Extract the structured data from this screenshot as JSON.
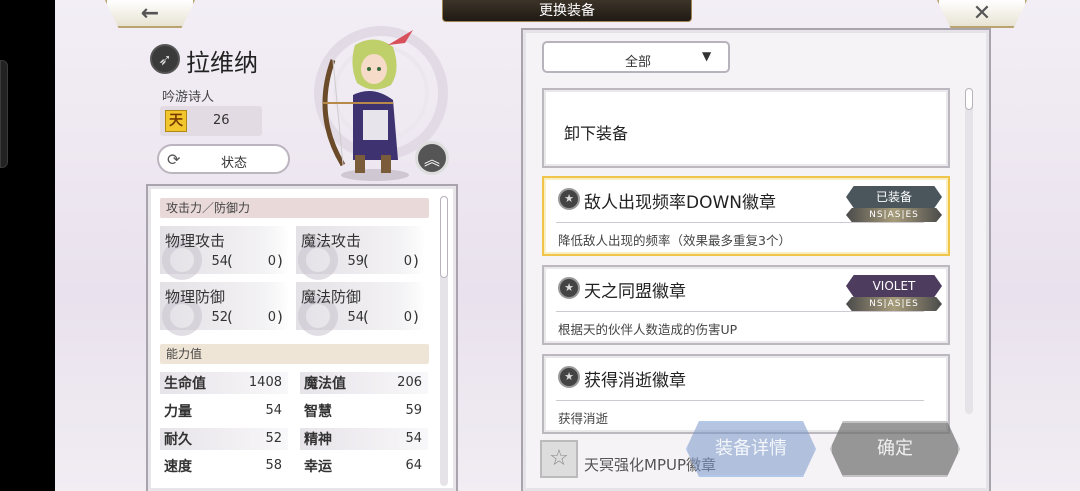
{
  "header": {
    "title": "更换装备",
    "back_icon": "←",
    "close_icon": "✕"
  },
  "character": {
    "name": "拉维纳",
    "class": "吟游诗人",
    "rank_glyph": "天",
    "level": "26",
    "status_label": "状态"
  },
  "stats": {
    "attack_defense_header": "攻击力／防御力",
    "physical_attack": {
      "label": "物理攻击",
      "base": "54",
      "bonus": "0"
    },
    "magic_attack": {
      "label": "魔法攻击",
      "base": "59",
      "bonus": "0"
    },
    "physical_defense": {
      "label": "物理防御",
      "base": "52",
      "bonus": "0"
    },
    "magic_defense": {
      "label": "魔法防御",
      "base": "54",
      "bonus": "0"
    },
    "ability_header": "能力值",
    "abilities": [
      {
        "label": "生命值",
        "value": "1408"
      },
      {
        "label": "魔法值",
        "value": "206"
      },
      {
        "label": "力量",
        "value": "54"
      },
      {
        "label": "智慧",
        "value": "59"
      },
      {
        "label": "耐久",
        "value": "52"
      },
      {
        "label": "精神",
        "value": "54"
      },
      {
        "label": "速度",
        "value": "58"
      },
      {
        "label": "幸运",
        "value": "64"
      }
    ]
  },
  "equipment": {
    "filter_value": "全部",
    "unequip_label": "卸下装备",
    "items": [
      {
        "name": "敌人出现频率DOWN徽章",
        "desc": "降低敌人出现的频率（效果最多重复3个）",
        "tag": "已装备",
        "tag2": "NS|AS|ES"
      },
      {
        "name": "天之同盟徽章",
        "desc": "根据天的伙伴人数造成的伤害UP",
        "tag": "VIOLET",
        "tag2": "NS|AS|ES"
      },
      {
        "name": "获得消逝徽章",
        "desc": "获得消逝"
      },
      {
        "name": "天冥强化MPUP徽章"
      }
    ],
    "detail_button": "装备详情",
    "confirm_button": "确定"
  },
  "colors": {
    "selected_border": "#f0c64a",
    "equipped_tag": "#4a565c",
    "violet_tag": "#4d3c5e"
  }
}
